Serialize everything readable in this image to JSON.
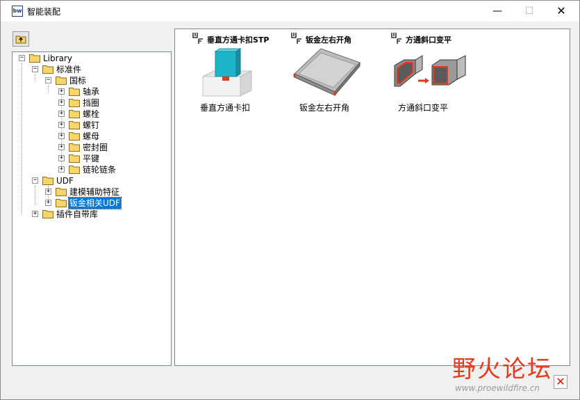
{
  "window": {
    "title": "智能装配",
    "app_icon_text": "bw",
    "minimize_glyph": "—",
    "maximize_glyph": "☐",
    "close_glyph": "✕"
  },
  "toolbar": {
    "up_icon": "folder-up-icon"
  },
  "tree": {
    "root": "Library",
    "standard_parts": "标准件",
    "gb": "国标",
    "gb_children": [
      "轴承",
      "挡圈",
      "螺栓",
      "螺钉",
      "螺母",
      "密封圈",
      "平键",
      "链轮链条"
    ],
    "udf": "UDF",
    "udf_children": [
      "建模辅助特征",
      "钣金相关UDF"
    ],
    "plugin_lib": "插件自带库",
    "selected": "钣金相关UDF"
  },
  "features": [
    {
      "header": "垂直方通卡扣STP",
      "caption": "垂直方通卡扣",
      "icon": "udf-badge-icon"
    },
    {
      "header": "钣金左右开角",
      "caption": "钣金左右开角",
      "icon": "udf-badge-icon"
    },
    {
      "header": "方通斜口变平",
      "caption": "方通斜口变平",
      "icon": "udf-badge-icon"
    }
  ],
  "watermark": {
    "title": "野火论坛",
    "url": "www.proewildfire.cn"
  },
  "colors": {
    "accent_selection": "#0078d7",
    "cyan_part": "#1fb5c8",
    "watermark_red": "#e23b1e"
  }
}
